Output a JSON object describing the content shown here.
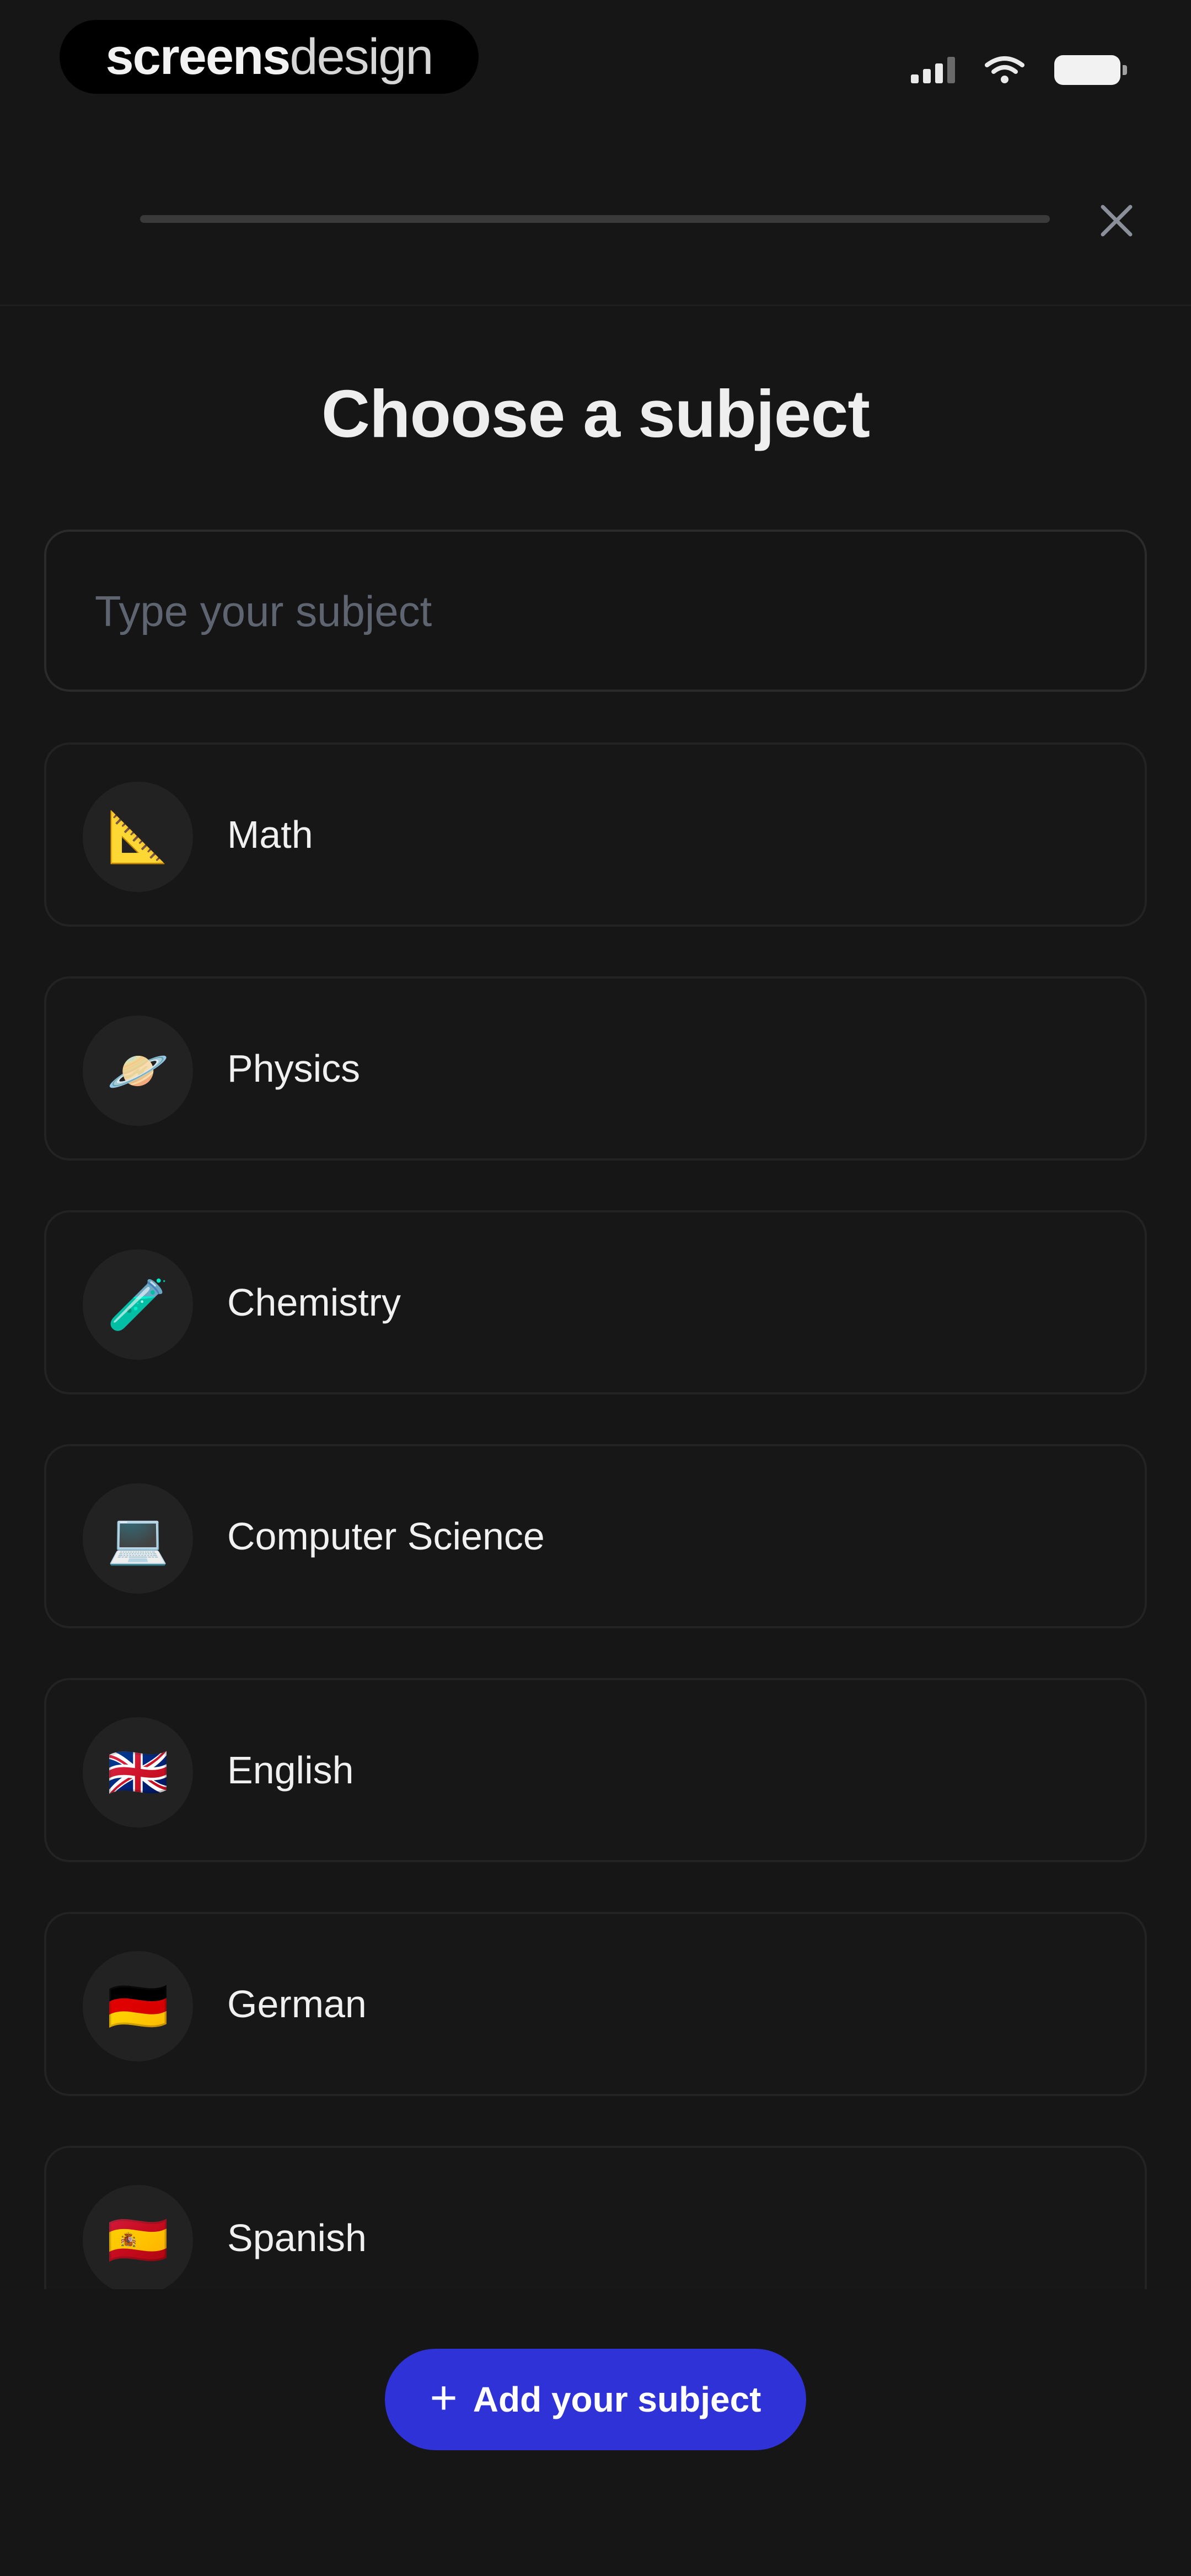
{
  "status_bar": {
    "brand_bold": "screens",
    "brand_light": "design"
  },
  "progress": {
    "value": 0
  },
  "header": {
    "close_icon": "close-icon"
  },
  "title": "Choose a subject",
  "search": {
    "placeholder": "Type your subject",
    "value": ""
  },
  "subjects": [
    {
      "label": "Math",
      "emoji": "📐"
    },
    {
      "label": "Physics",
      "emoji": "🪐"
    },
    {
      "label": "Chemistry",
      "emoji": "🧪"
    },
    {
      "label": "Computer Science",
      "emoji": "💻"
    },
    {
      "label": "English",
      "emoji": "🇬🇧"
    },
    {
      "label": "German",
      "emoji": "🇩🇪"
    },
    {
      "label": "Spanish",
      "emoji": "🇪🇸"
    }
  ],
  "add_button": {
    "icon": "+",
    "label": "Add your subject"
  },
  "colors": {
    "background": "#161616",
    "accent": "#2f32d6"
  }
}
